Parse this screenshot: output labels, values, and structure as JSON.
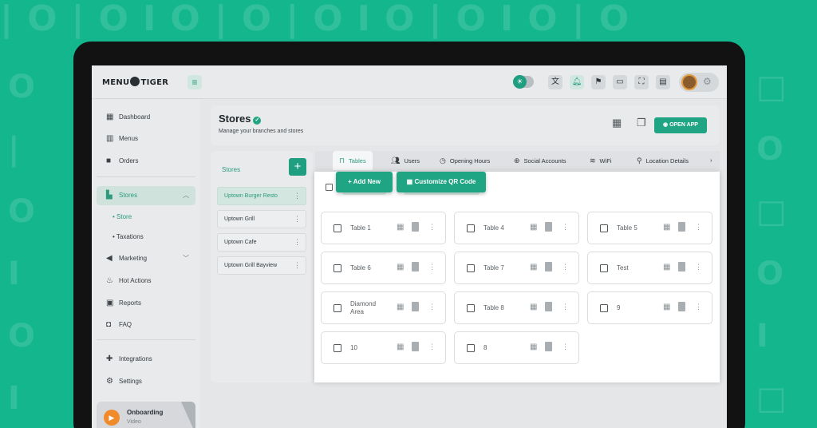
{
  "app": {
    "logo_text_left": "MENU",
    "logo_text_right": "TIGER"
  },
  "topbar": {
    "icons": [
      "translate-icon",
      "bell-icon",
      "flag-icon",
      "devices-icon",
      "fullscreen-icon",
      "notes-icon",
      "gear-icon"
    ]
  },
  "sidebar": {
    "items": [
      {
        "label": "Dashboard",
        "icon": "dashboard-icon"
      },
      {
        "label": "Menus",
        "icon": "menus-icon"
      },
      {
        "label": "Orders",
        "icon": "orders-icon"
      },
      {
        "label": "Stores",
        "icon": "stores-icon"
      },
      {
        "label": "Marketing",
        "icon": "marketing-icon"
      },
      {
        "label": "Hot Actions",
        "icon": "flame-icon"
      },
      {
        "label": "Reports",
        "icon": "reports-icon"
      },
      {
        "label": "FAQ",
        "icon": "faq-icon"
      },
      {
        "label": "Integrations",
        "icon": "puzzle-icon"
      },
      {
        "label": "Settings",
        "icon": "gear-icon"
      }
    ],
    "sub_items": [
      {
        "label": "Store"
      },
      {
        "label": "Taxations"
      }
    ],
    "onboarding": {
      "title": "Onboarding",
      "subtitle": "Video"
    }
  },
  "page": {
    "title": "Stores",
    "subtitle": "Manage your branches and stores",
    "open_app_label": "OPEN APP"
  },
  "stores": {
    "label": "Stores",
    "list": [
      {
        "name": "Uptown Burger Resto"
      },
      {
        "name": "Uptown Grill"
      },
      {
        "name": "Uptown Cafe"
      },
      {
        "name": "Uptown Grill Bayview"
      }
    ]
  },
  "tabs": [
    {
      "label": "Tables",
      "icon": "table-icon"
    },
    {
      "label": "Users",
      "icon": "users-icon"
    },
    {
      "label": "Opening Hours",
      "icon": "clock-icon"
    },
    {
      "label": "Social Accounts",
      "icon": "globe-icon"
    },
    {
      "label": "WiFi",
      "icon": "wifi-icon"
    },
    {
      "label": "Location Details",
      "icon": "pin-icon"
    }
  ],
  "actions": {
    "add_new": "Add New",
    "customize_qr": "Customize QR Code"
  },
  "tables": [
    {
      "name": "Table 1"
    },
    {
      "name": "Table 4"
    },
    {
      "name": "Table 5"
    },
    {
      "name": "Table 6"
    },
    {
      "name": "Table 7"
    },
    {
      "name": "Test"
    },
    {
      "name": "Diamond Area"
    },
    {
      "name": "Table 8"
    },
    {
      "name": "9"
    },
    {
      "name": "10"
    },
    {
      "name": "8"
    }
  ],
  "colors": {
    "background": "#14b68d",
    "accent": "#1fa583",
    "accent_text": "#2b9a7d"
  }
}
